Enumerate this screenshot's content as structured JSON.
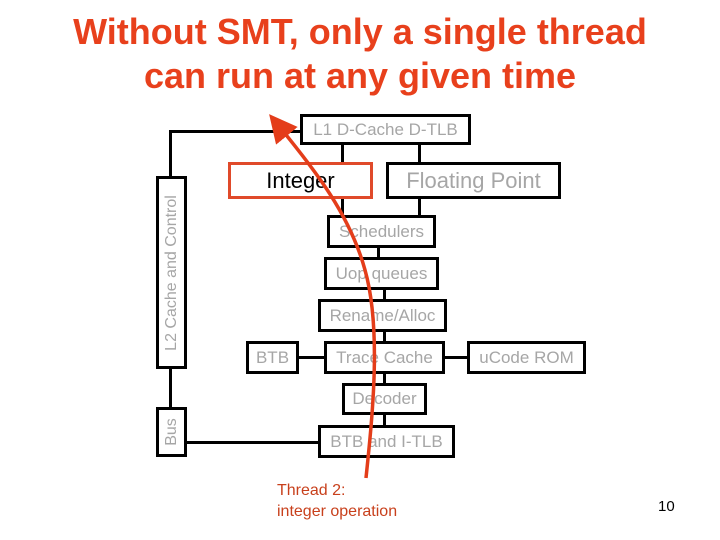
{
  "slide": {
    "title_line1": "Without SMT, only a single thread",
    "title_line2": "can run at any given time",
    "page_number": "10"
  },
  "diagram": {
    "blocks": {
      "l1_cache": "L1 D-Cache D-TLB",
      "integer": "Integer",
      "floating_point": "Floating Point",
      "schedulers": "Schedulers",
      "uop_queues": "Uop queues",
      "rename_alloc": "Rename/Alloc",
      "btb": "BTB",
      "trace_cache": "Trace Cache",
      "ucode_rom": "uCode ROM",
      "decoder": "Decoder",
      "btb_itlb": "BTB and I-TLB",
      "l2_cache": "L2 Cache and Control",
      "bus": "Bus"
    },
    "active_block": "integer",
    "annotation": {
      "line1": "Thread 2:",
      "line2": "integer operation"
    },
    "colors": {
      "title": "#e8401c",
      "highlight": "#e04a2a",
      "inactive_text": "#a6a6a6",
      "arrow": "#e43d1a"
    }
  }
}
